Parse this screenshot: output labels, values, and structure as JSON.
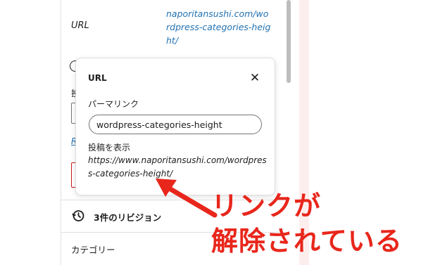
{
  "sidebar": {
    "url_label": "URL",
    "url_value": "naporitansushi.com/wordpress-categories-height/",
    "hidden_text": "投",
    "hidden_link": "R"
  },
  "popover": {
    "title": "URL",
    "close_icon": "close-icon",
    "permalink_label": "パーマリンク",
    "slug_value": "wordpress-categories-height",
    "view_label": "投稿を表示",
    "view_link": "https://www.naporitansushi.com/wordpress-categories-height/"
  },
  "revisions": {
    "icon": "history-icon",
    "label": "3件のリビジョン"
  },
  "categories": {
    "label": "カテゴリー"
  },
  "annotation": {
    "line1": "リンクが",
    "line2": "解除されている",
    "color": "#e8261b"
  }
}
